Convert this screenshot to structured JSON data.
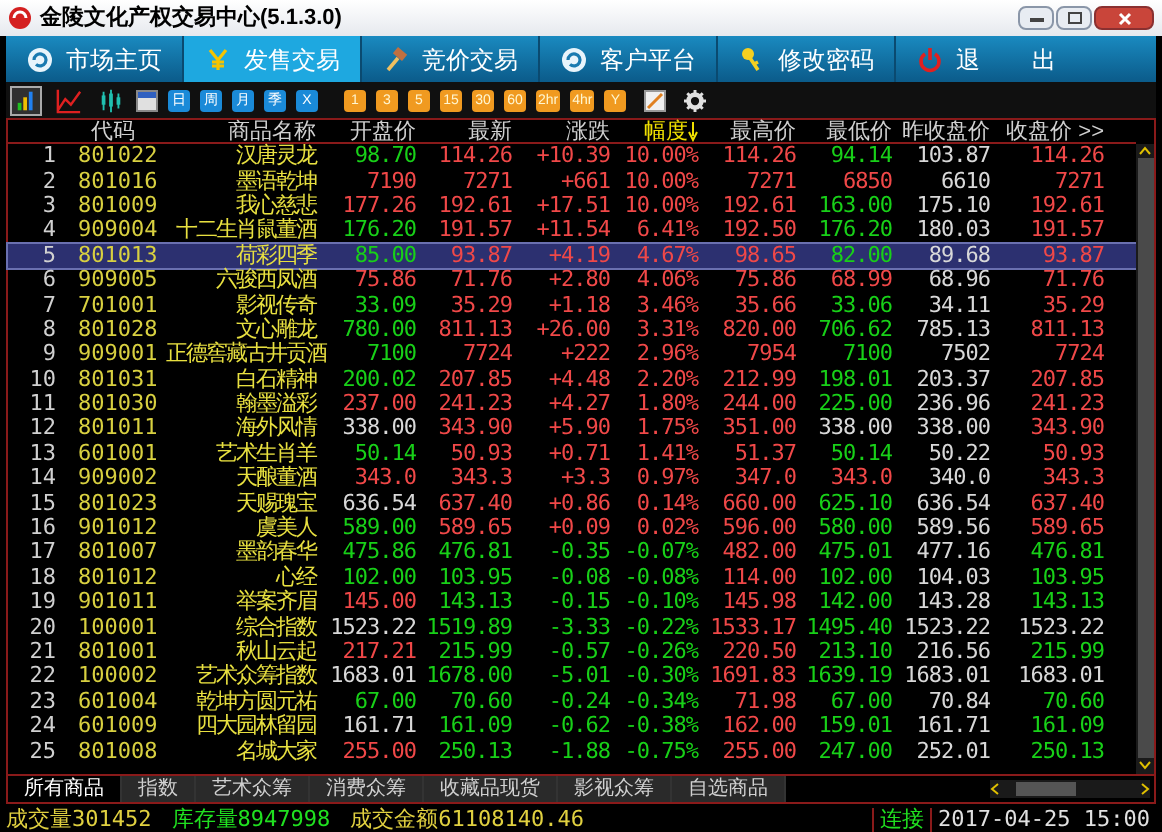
{
  "window": {
    "title": "金陵文化产权交易中心(5.1.3.0)"
  },
  "nav": [
    {
      "label": "市场主页",
      "selected": false
    },
    {
      "label": "发售交易",
      "selected": true
    },
    {
      "label": "竞价交易",
      "selected": false
    },
    {
      "label": "客户平台",
      "selected": false
    },
    {
      "label": "修改密码",
      "selected": false
    },
    {
      "label": "退",
      "label_2": "出",
      "selected": false
    }
  ],
  "toolbar": {
    "view_buttons": [
      {
        "selected": true
      },
      {
        "selected": false
      },
      {
        "selected": false
      }
    ],
    "period_keys": [
      {
        "label": "日",
        "kind": "blue"
      },
      {
        "label": "周",
        "kind": "blue"
      },
      {
        "label": "月",
        "kind": "blue"
      },
      {
        "label": "季",
        "kind": "blue"
      },
      {
        "label": "X",
        "kind": "blue"
      },
      {
        "label": "1",
        "kind": "orange"
      },
      {
        "label": "3",
        "kind": "orange"
      },
      {
        "label": "5",
        "kind": "orange"
      },
      {
        "label": "15",
        "kind": "orange"
      },
      {
        "label": "30",
        "kind": "orange"
      },
      {
        "label": "60",
        "kind": "orange"
      },
      {
        "label": "2hr",
        "kind": "orange"
      },
      {
        "label": "4hr",
        "kind": "orange"
      },
      {
        "label": "Y",
        "kind": "orange"
      }
    ]
  },
  "table": {
    "columns": [
      {
        "label": "代码",
        "sorted": false
      },
      {
        "label": "商品名称",
        "sorted": false
      },
      {
        "label": "开盘价",
        "sorted": false
      },
      {
        "label": "最新",
        "sorted": false
      },
      {
        "label": "涨跌",
        "sorted": false
      },
      {
        "label": "幅度",
        "sorted": true
      },
      {
        "label": "最高价",
        "sorted": false
      },
      {
        "label": "最低价",
        "sorted": false
      },
      {
        "label": "昨收盘价",
        "sorted": false
      },
      {
        "label": "收盘价 >>",
        "sorted": false
      }
    ],
    "rows": [
      {
        "index": "1",
        "selected": false,
        "cells": [
          {
            "text": "801022"
          },
          {
            "text": "汉唐灵龙"
          },
          {
            "text": "98.70",
            "color": "#18d018"
          },
          {
            "text": "114.26",
            "color": "#f04848"
          },
          {
            "text": "+10.39",
            "color": "#f04848"
          },
          {
            "text": "10.00%",
            "color": "#f04848"
          },
          {
            "text": "114.26",
            "color": "#f04848"
          },
          {
            "text": "94.14",
            "color": "#18d018"
          },
          {
            "text": "103.87",
            "color": "#d8d8d8"
          },
          {
            "text": "114.26",
            "color": "#f04848"
          }
        ]
      },
      {
        "index": "2",
        "selected": false,
        "cells": [
          {
            "text": "801016"
          },
          {
            "text": "墨语乾坤"
          },
          {
            "text": "7190",
            "color": "#f04848"
          },
          {
            "text": "7271",
            "color": "#f04848"
          },
          {
            "text": "+661",
            "color": "#f04848"
          },
          {
            "text": "10.00%",
            "color": "#f04848"
          },
          {
            "text": "7271",
            "color": "#f04848"
          },
          {
            "text": "6850",
            "color": "#f04848"
          },
          {
            "text": "6610",
            "color": "#d8d8d8"
          },
          {
            "text": "7271",
            "color": "#f04848"
          }
        ]
      },
      {
        "index": "3",
        "selected": false,
        "cells": [
          {
            "text": "801009"
          },
          {
            "text": "我心慈悲"
          },
          {
            "text": "177.26",
            "color": "#f04848"
          },
          {
            "text": "192.61",
            "color": "#f04848"
          },
          {
            "text": "+17.51",
            "color": "#f04848"
          },
          {
            "text": "10.00%",
            "color": "#f04848"
          },
          {
            "text": "192.61",
            "color": "#f04848"
          },
          {
            "text": "163.00",
            "color": "#18d018"
          },
          {
            "text": "175.10",
            "color": "#d8d8d8"
          },
          {
            "text": "192.61",
            "color": "#f04848"
          }
        ]
      },
      {
        "index": "4",
        "selected": false,
        "cells": [
          {
            "text": "909004"
          },
          {
            "text": "十二生肖鼠董酒"
          },
          {
            "text": "176.20",
            "color": "#18d018"
          },
          {
            "text": "191.57",
            "color": "#f04848"
          },
          {
            "text": "+11.54",
            "color": "#f04848"
          },
          {
            "text": "6.41%",
            "color": "#f04848"
          },
          {
            "text": "192.50",
            "color": "#f04848"
          },
          {
            "text": "176.20",
            "color": "#18d018"
          },
          {
            "text": "180.03",
            "color": "#d8d8d8"
          },
          {
            "text": "191.57",
            "color": "#f04848"
          }
        ]
      },
      {
        "index": "5",
        "selected": true,
        "cells": [
          {
            "text": "801013"
          },
          {
            "text": "荷彩四季"
          },
          {
            "text": "85.00",
            "color": "#18d018"
          },
          {
            "text": "93.87",
            "color": "#f04848"
          },
          {
            "text": "+4.19",
            "color": "#f04848"
          },
          {
            "text": "4.67%",
            "color": "#f04848"
          },
          {
            "text": "98.65",
            "color": "#f04848"
          },
          {
            "text": "82.00",
            "color": "#18d018"
          },
          {
            "text": "89.68",
            "color": "#d8d8d8"
          },
          {
            "text": "93.87",
            "color": "#f04848"
          }
        ]
      },
      {
        "index": "6",
        "selected": false,
        "cells": [
          {
            "text": "909005"
          },
          {
            "text": "六骏西凤酒"
          },
          {
            "text": "75.86",
            "color": "#f04848"
          },
          {
            "text": "71.76",
            "color": "#f04848"
          },
          {
            "text": "+2.80",
            "color": "#f04848"
          },
          {
            "text": "4.06%",
            "color": "#f04848"
          },
          {
            "text": "75.86",
            "color": "#f04848"
          },
          {
            "text": "68.99",
            "color": "#f04848"
          },
          {
            "text": "68.96",
            "color": "#d8d8d8"
          },
          {
            "text": "71.76",
            "color": "#f04848"
          }
        ]
      },
      {
        "index": "7",
        "selected": false,
        "cells": [
          {
            "text": "701001"
          },
          {
            "text": "影视传奇"
          },
          {
            "text": "33.09",
            "color": "#18d018"
          },
          {
            "text": "35.29",
            "color": "#f04848"
          },
          {
            "text": "+1.18",
            "color": "#f04848"
          },
          {
            "text": "3.46%",
            "color": "#f04848"
          },
          {
            "text": "35.66",
            "color": "#f04848"
          },
          {
            "text": "33.06",
            "color": "#18d018"
          },
          {
            "text": "34.11",
            "color": "#d8d8d8"
          },
          {
            "text": "35.29",
            "color": "#f04848"
          }
        ]
      },
      {
        "index": "8",
        "selected": false,
        "cells": [
          {
            "text": "801028"
          },
          {
            "text": "文心雕龙"
          },
          {
            "text": "780.00",
            "color": "#18d018"
          },
          {
            "text": "811.13",
            "color": "#f04848"
          },
          {
            "text": "+26.00",
            "color": "#f04848"
          },
          {
            "text": "3.31%",
            "color": "#f04848"
          },
          {
            "text": "820.00",
            "color": "#f04848"
          },
          {
            "text": "706.62",
            "color": "#18d018"
          },
          {
            "text": "785.13",
            "color": "#d8d8d8"
          },
          {
            "text": "811.13",
            "color": "#f04848"
          }
        ]
      },
      {
        "index": "9",
        "selected": false,
        "cells": [
          {
            "text": "909001"
          },
          {
            "text": "正德窖藏古井贡酒"
          },
          {
            "text": "7100",
            "color": "#18d018"
          },
          {
            "text": "7724",
            "color": "#f04848"
          },
          {
            "text": "+222",
            "color": "#f04848"
          },
          {
            "text": "2.96%",
            "color": "#f04848"
          },
          {
            "text": "7954",
            "color": "#f04848"
          },
          {
            "text": "7100",
            "color": "#18d018"
          },
          {
            "text": "7502",
            "color": "#d8d8d8"
          },
          {
            "text": "7724",
            "color": "#f04848"
          }
        ]
      },
      {
        "index": "10",
        "selected": false,
        "cells": [
          {
            "text": "801031"
          },
          {
            "text": "白石精神"
          },
          {
            "text": "200.02",
            "color": "#18d018"
          },
          {
            "text": "207.85",
            "color": "#f04848"
          },
          {
            "text": "+4.48",
            "color": "#f04848"
          },
          {
            "text": "2.20%",
            "color": "#f04848"
          },
          {
            "text": "212.99",
            "color": "#f04848"
          },
          {
            "text": "198.01",
            "color": "#18d018"
          },
          {
            "text": "203.37",
            "color": "#d8d8d8"
          },
          {
            "text": "207.85",
            "color": "#f04848"
          }
        ]
      },
      {
        "index": "11",
        "selected": false,
        "cells": [
          {
            "text": "801030"
          },
          {
            "text": "翰墨溢彩"
          },
          {
            "text": "237.00",
            "color": "#f04848"
          },
          {
            "text": "241.23",
            "color": "#f04848"
          },
          {
            "text": "+4.27",
            "color": "#f04848"
          },
          {
            "text": "1.80%",
            "color": "#f04848"
          },
          {
            "text": "244.00",
            "color": "#f04848"
          },
          {
            "text": "225.00",
            "color": "#18d018"
          },
          {
            "text": "236.96",
            "color": "#d8d8d8"
          },
          {
            "text": "241.23",
            "color": "#f04848"
          }
        ]
      },
      {
        "index": "12",
        "selected": false,
        "cells": [
          {
            "text": "801011"
          },
          {
            "text": "海外风情"
          },
          {
            "text": "338.00",
            "color": "#d8d8d8"
          },
          {
            "text": "343.90",
            "color": "#f04848"
          },
          {
            "text": "+5.90",
            "color": "#f04848"
          },
          {
            "text": "1.75%",
            "color": "#f04848"
          },
          {
            "text": "351.00",
            "color": "#f04848"
          },
          {
            "text": "338.00",
            "color": "#d8d8d8"
          },
          {
            "text": "338.00",
            "color": "#d8d8d8"
          },
          {
            "text": "343.90",
            "color": "#f04848"
          }
        ]
      },
      {
        "index": "13",
        "selected": false,
        "cells": [
          {
            "text": "601001"
          },
          {
            "text": "艺术生肖羊"
          },
          {
            "text": "50.14",
            "color": "#18d018"
          },
          {
            "text": "50.93",
            "color": "#f04848"
          },
          {
            "text": "+0.71",
            "color": "#f04848"
          },
          {
            "text": "1.41%",
            "color": "#f04848"
          },
          {
            "text": "51.37",
            "color": "#f04848"
          },
          {
            "text": "50.14",
            "color": "#18d018"
          },
          {
            "text": "50.22",
            "color": "#d8d8d8"
          },
          {
            "text": "50.93",
            "color": "#f04848"
          }
        ]
      },
      {
        "index": "14",
        "selected": false,
        "cells": [
          {
            "text": "909002"
          },
          {
            "text": "天酿董酒"
          },
          {
            "text": "343.0",
            "color": "#f04848"
          },
          {
            "text": "343.3",
            "color": "#f04848"
          },
          {
            "text": "+3.3",
            "color": "#f04848"
          },
          {
            "text": "0.97%",
            "color": "#f04848"
          },
          {
            "text": "347.0",
            "color": "#f04848"
          },
          {
            "text": "343.0",
            "color": "#f04848"
          },
          {
            "text": "340.0",
            "color": "#d8d8d8"
          },
          {
            "text": "343.3",
            "color": "#f04848"
          }
        ]
      },
      {
        "index": "15",
        "selected": false,
        "cells": [
          {
            "text": "801023"
          },
          {
            "text": "天赐瑰宝"
          },
          {
            "text": "636.54",
            "color": "#d8d8d8"
          },
          {
            "text": "637.40",
            "color": "#f04848"
          },
          {
            "text": "+0.86",
            "color": "#f04848"
          },
          {
            "text": "0.14%",
            "color": "#f04848"
          },
          {
            "text": "660.00",
            "color": "#f04848"
          },
          {
            "text": "625.10",
            "color": "#18d018"
          },
          {
            "text": "636.54",
            "color": "#d8d8d8"
          },
          {
            "text": "637.40",
            "color": "#f04848"
          }
        ]
      },
      {
        "index": "16",
        "selected": false,
        "cells": [
          {
            "text": "901012"
          },
          {
            "text": "虞美人"
          },
          {
            "text": "589.00",
            "color": "#18d018"
          },
          {
            "text": "589.65",
            "color": "#f04848"
          },
          {
            "text": "+0.09",
            "color": "#f04848"
          },
          {
            "text": "0.02%",
            "color": "#f04848"
          },
          {
            "text": "596.00",
            "color": "#f04848"
          },
          {
            "text": "580.00",
            "color": "#18d018"
          },
          {
            "text": "589.56",
            "color": "#d8d8d8"
          },
          {
            "text": "589.65",
            "color": "#f04848"
          }
        ]
      },
      {
        "index": "17",
        "selected": false,
        "cells": [
          {
            "text": "801007"
          },
          {
            "text": "墨韵春华"
          },
          {
            "text": "475.86",
            "color": "#18d018"
          },
          {
            "text": "476.81",
            "color": "#18d018"
          },
          {
            "text": "-0.35",
            "color": "#18d018"
          },
          {
            "text": "-0.07%",
            "color": "#18d018"
          },
          {
            "text": "482.00",
            "color": "#f04848"
          },
          {
            "text": "475.01",
            "color": "#18d018"
          },
          {
            "text": "477.16",
            "color": "#d8d8d8"
          },
          {
            "text": "476.81",
            "color": "#18d018"
          }
        ]
      },
      {
        "index": "18",
        "selected": false,
        "cells": [
          {
            "text": "801012"
          },
          {
            "text": "心经"
          },
          {
            "text": "102.00",
            "color": "#18d018"
          },
          {
            "text": "103.95",
            "color": "#18d018"
          },
          {
            "text": "-0.08",
            "color": "#18d018"
          },
          {
            "text": "-0.08%",
            "color": "#18d018"
          },
          {
            "text": "114.00",
            "color": "#f04848"
          },
          {
            "text": "102.00",
            "color": "#18d018"
          },
          {
            "text": "104.03",
            "color": "#d8d8d8"
          },
          {
            "text": "103.95",
            "color": "#18d018"
          }
        ]
      },
      {
        "index": "19",
        "selected": false,
        "cells": [
          {
            "text": "901011"
          },
          {
            "text": "举案齐眉"
          },
          {
            "text": "145.00",
            "color": "#f04848"
          },
          {
            "text": "143.13",
            "color": "#18d018"
          },
          {
            "text": "-0.15",
            "color": "#18d018"
          },
          {
            "text": "-0.10%",
            "color": "#18d018"
          },
          {
            "text": "145.98",
            "color": "#f04848"
          },
          {
            "text": "142.00",
            "color": "#18d018"
          },
          {
            "text": "143.28",
            "color": "#d8d8d8"
          },
          {
            "text": "143.13",
            "color": "#18d018"
          }
        ]
      },
      {
        "index": "20",
        "selected": false,
        "cells": [
          {
            "text": "100001"
          },
          {
            "text": "综合指数"
          },
          {
            "text": "1523.22",
            "color": "#d8d8d8"
          },
          {
            "text": "1519.89",
            "color": "#18d018"
          },
          {
            "text": "-3.33",
            "color": "#18d018"
          },
          {
            "text": "-0.22%",
            "color": "#18d018"
          },
          {
            "text": "1533.17",
            "color": "#f04848"
          },
          {
            "text": "1495.40",
            "color": "#18d018"
          },
          {
            "text": "1523.22",
            "color": "#d8d8d8"
          },
          {
            "text": "1523.22",
            "color": "#d8d8d8"
          }
        ]
      },
      {
        "index": "21",
        "selected": false,
        "cells": [
          {
            "text": "801001"
          },
          {
            "text": "秋山云起"
          },
          {
            "text": "217.21",
            "color": "#f04848"
          },
          {
            "text": "215.99",
            "color": "#18d018"
          },
          {
            "text": "-0.57",
            "color": "#18d018"
          },
          {
            "text": "-0.26%",
            "color": "#18d018"
          },
          {
            "text": "220.50",
            "color": "#f04848"
          },
          {
            "text": "213.10",
            "color": "#18d018"
          },
          {
            "text": "216.56",
            "color": "#d8d8d8"
          },
          {
            "text": "215.99",
            "color": "#18d018"
          }
        ]
      },
      {
        "index": "22",
        "selected": false,
        "cells": [
          {
            "text": "100002"
          },
          {
            "text": "艺术众筹指数"
          },
          {
            "text": "1683.01",
            "color": "#d8d8d8"
          },
          {
            "text": "1678.00",
            "color": "#18d018"
          },
          {
            "text": "-5.01",
            "color": "#18d018"
          },
          {
            "text": "-0.30%",
            "color": "#18d018"
          },
          {
            "text": "1691.83",
            "color": "#f04848"
          },
          {
            "text": "1639.19",
            "color": "#18d018"
          },
          {
            "text": "1683.01",
            "color": "#d8d8d8"
          },
          {
            "text": "1683.01",
            "color": "#d8d8d8"
          }
        ]
      },
      {
        "index": "23",
        "selected": false,
        "cells": [
          {
            "text": "601004"
          },
          {
            "text": "乾坤方圆元祐"
          },
          {
            "text": "67.00",
            "color": "#18d018"
          },
          {
            "text": "70.60",
            "color": "#18d018"
          },
          {
            "text": "-0.24",
            "color": "#18d018"
          },
          {
            "text": "-0.34%",
            "color": "#18d018"
          },
          {
            "text": "71.98",
            "color": "#f04848"
          },
          {
            "text": "67.00",
            "color": "#18d018"
          },
          {
            "text": "70.84",
            "color": "#d8d8d8"
          },
          {
            "text": "70.60",
            "color": "#18d018"
          }
        ]
      },
      {
        "index": "24",
        "selected": false,
        "cells": [
          {
            "text": "601009"
          },
          {
            "text": "四大园林留园"
          },
          {
            "text": "161.71",
            "color": "#d8d8d8"
          },
          {
            "text": "161.09",
            "color": "#18d018"
          },
          {
            "text": "-0.62",
            "color": "#18d018"
          },
          {
            "text": "-0.38%",
            "color": "#18d018"
          },
          {
            "text": "162.00",
            "color": "#f04848"
          },
          {
            "text": "159.01",
            "color": "#18d018"
          },
          {
            "text": "161.71",
            "color": "#d8d8d8"
          },
          {
            "text": "161.09",
            "color": "#18d018"
          }
        ]
      },
      {
        "index": "25",
        "selected": false,
        "cells": [
          {
            "text": "801008"
          },
          {
            "text": "名城大家"
          },
          {
            "text": "255.00",
            "color": "#f04848"
          },
          {
            "text": "250.13",
            "color": "#18d018"
          },
          {
            "text": "-1.88",
            "color": "#18d018"
          },
          {
            "text": "-0.75%",
            "color": "#18d018"
          },
          {
            "text": "255.00",
            "color": "#f04848"
          },
          {
            "text": "247.00",
            "color": "#18d018"
          },
          {
            "text": "252.01",
            "color": "#d8d8d8"
          },
          {
            "text": "250.13",
            "color": "#18d018"
          }
        ]
      }
    ]
  },
  "category_tabs": [
    {
      "label": "所有商品",
      "selected": true
    },
    {
      "label": "指数",
      "selected": false
    },
    {
      "label": "艺术众筹",
      "selected": false
    },
    {
      "label": "消费众筹",
      "selected": false
    },
    {
      "label": "收藏品现货",
      "selected": false
    },
    {
      "label": "影视众筹",
      "selected": false
    },
    {
      "label": "自选商品",
      "selected": false
    }
  ],
  "status_bar": {
    "stats": [
      {
        "label": "成交量",
        "value": "301452",
        "kind": "yellow"
      },
      {
        "label": "库存量",
        "value": "8947998",
        "kind": "green"
      },
      {
        "label": "成交金额",
        "value": "61108140.46",
        "kind": "yellow"
      }
    ],
    "connection": "连接",
    "datetime": "2017-04-25 15:00"
  }
}
